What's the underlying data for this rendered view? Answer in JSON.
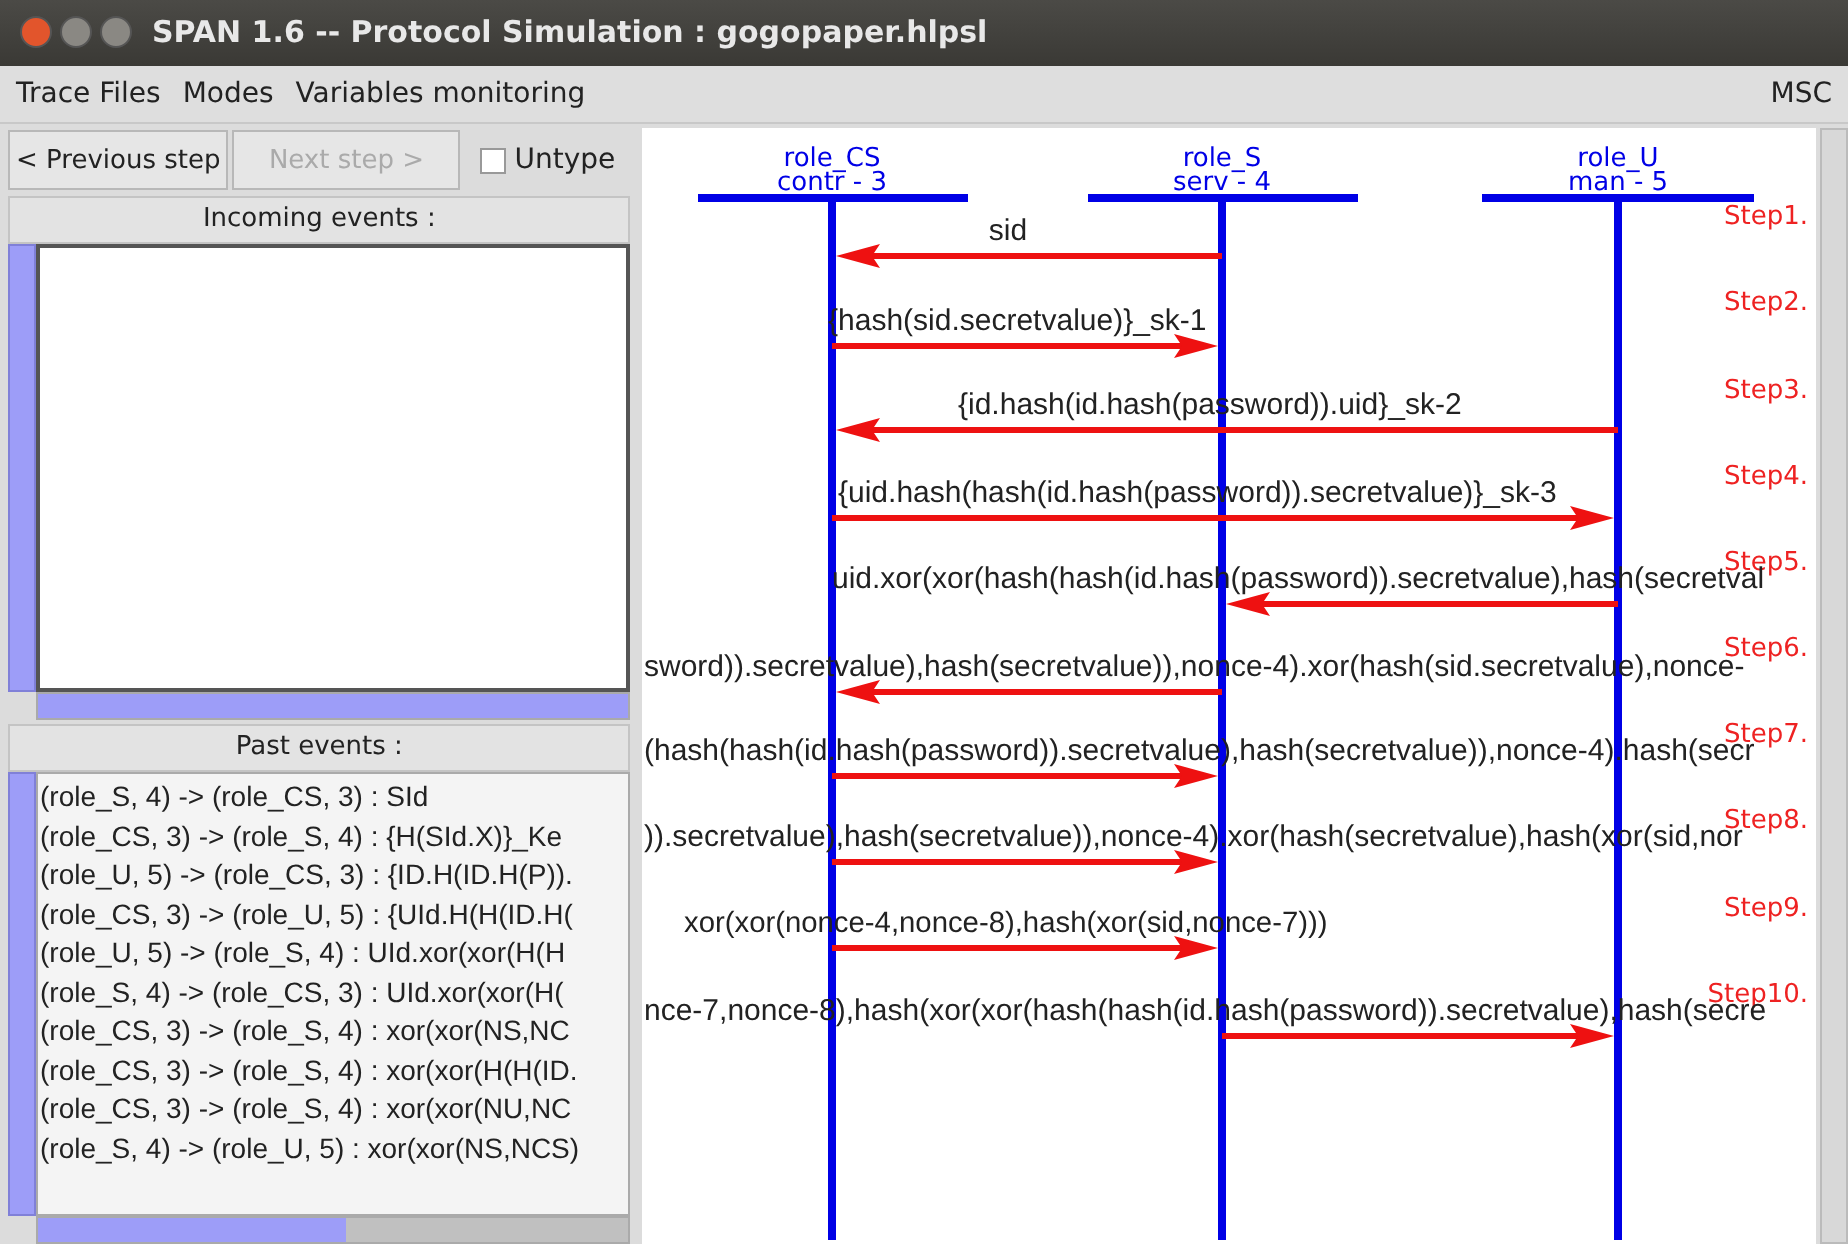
{
  "window": {
    "title": "SPAN 1.6 -- Protocol Simulation : gogopaper.hlpsl"
  },
  "menu": {
    "items": [
      "Trace Files",
      "Modes",
      "Variables monitoring"
    ],
    "right_label": "MSC"
  },
  "toolbar": {
    "buttons": [
      {
        "label": "< Previous step",
        "disabled": false
      },
      {
        "label": "Next step >",
        "disabled": true
      }
    ],
    "checkbox": {
      "label": "Untype",
      "checked": false
    }
  },
  "incoming_events": {
    "title": "Incoming events :"
  },
  "past_events": {
    "title": "Past events :",
    "items": [
      "(role_S, 4) -> (role_CS, 3) : SId",
      "(role_CS, 3) -> (role_S, 4) : {H(SId.X)}_Ke",
      "(role_U, 5) -> (role_CS, 3) : {ID.H(ID.H(P)).",
      "(role_CS, 3) -> (role_U, 5) : {UId.H(H(ID.H(",
      "(role_U, 5) -> (role_S, 4) : UId.xor(xor(H(H",
      "(role_S, 4) -> (role_CS, 3) : UId.xor(xor(H(",
      "(role_CS, 3) -> (role_S, 4) : xor(xor(NS,NC",
      "(role_CS, 3) -> (role_S, 4) : xor(xor(H(H(ID.",
      "(role_CS, 3) -> (role_S, 4) : xor(xor(NU,NC",
      "(role_S, 4) -> (role_U, 5) : xor(xor(NS,NCS)"
    ]
  },
  "msc": {
    "roles": [
      {
        "name": "role_CS",
        "agent": "contr - 3"
      },
      {
        "name": "role_S",
        "agent": "serv - 4"
      },
      {
        "name": "role_U",
        "agent": "man - 5"
      }
    ],
    "messages": [
      {
        "step": "Step1.",
        "kind": "StoCS",
        "text": "sid"
      },
      {
        "step": "Step2.",
        "kind": "CStoS",
        "text": "{hash(sid.secretvalue)}_sk-1"
      },
      {
        "step": "Step3.",
        "kind": "UtoCS",
        "text": "{id.hash(id.hash(password)).uid}_sk-2"
      },
      {
        "step": "Step4.",
        "kind": "CStoU",
        "text": "{uid.hash(hash(id.hash(password)).secretvalue)}_sk-3"
      },
      {
        "step": "Step5.",
        "kind": "UtoS",
        "text": "uid.xor(xor(hash(hash(id.hash(password)).secretvalue),hash(secretval"
      },
      {
        "step": "Step6.",
        "kind": "StoCS",
        "text": "sword)).secretvalue),hash(secretvalue)),nonce-4).xor(hash(sid.secretvalue),nonce-"
      },
      {
        "step": "Step7.",
        "kind": "CStoS",
        "text": "(hash(hash(id.hash(password)).secretvalue),hash(secretvalue)),nonce-4).hash(secr"
      },
      {
        "step": "Step8.",
        "kind": "CStoS",
        "text": ")).secretvalue),hash(secretvalue)),nonce-4).xor(hash(secretvalue),hash(xor(sid,nor"
      },
      {
        "step": "Step9.",
        "kind": "CStoS",
        "text": "xor(xor(nonce-4,nonce-8),hash(xor(sid,nonce-7)))"
      },
      {
        "step": "Step10.",
        "kind": "StoU",
        "text": "nce-7,nonce-8),hash(xor(xor(hash(hash(id.hash(password)).secretvalue),hash(secre"
      }
    ]
  }
}
